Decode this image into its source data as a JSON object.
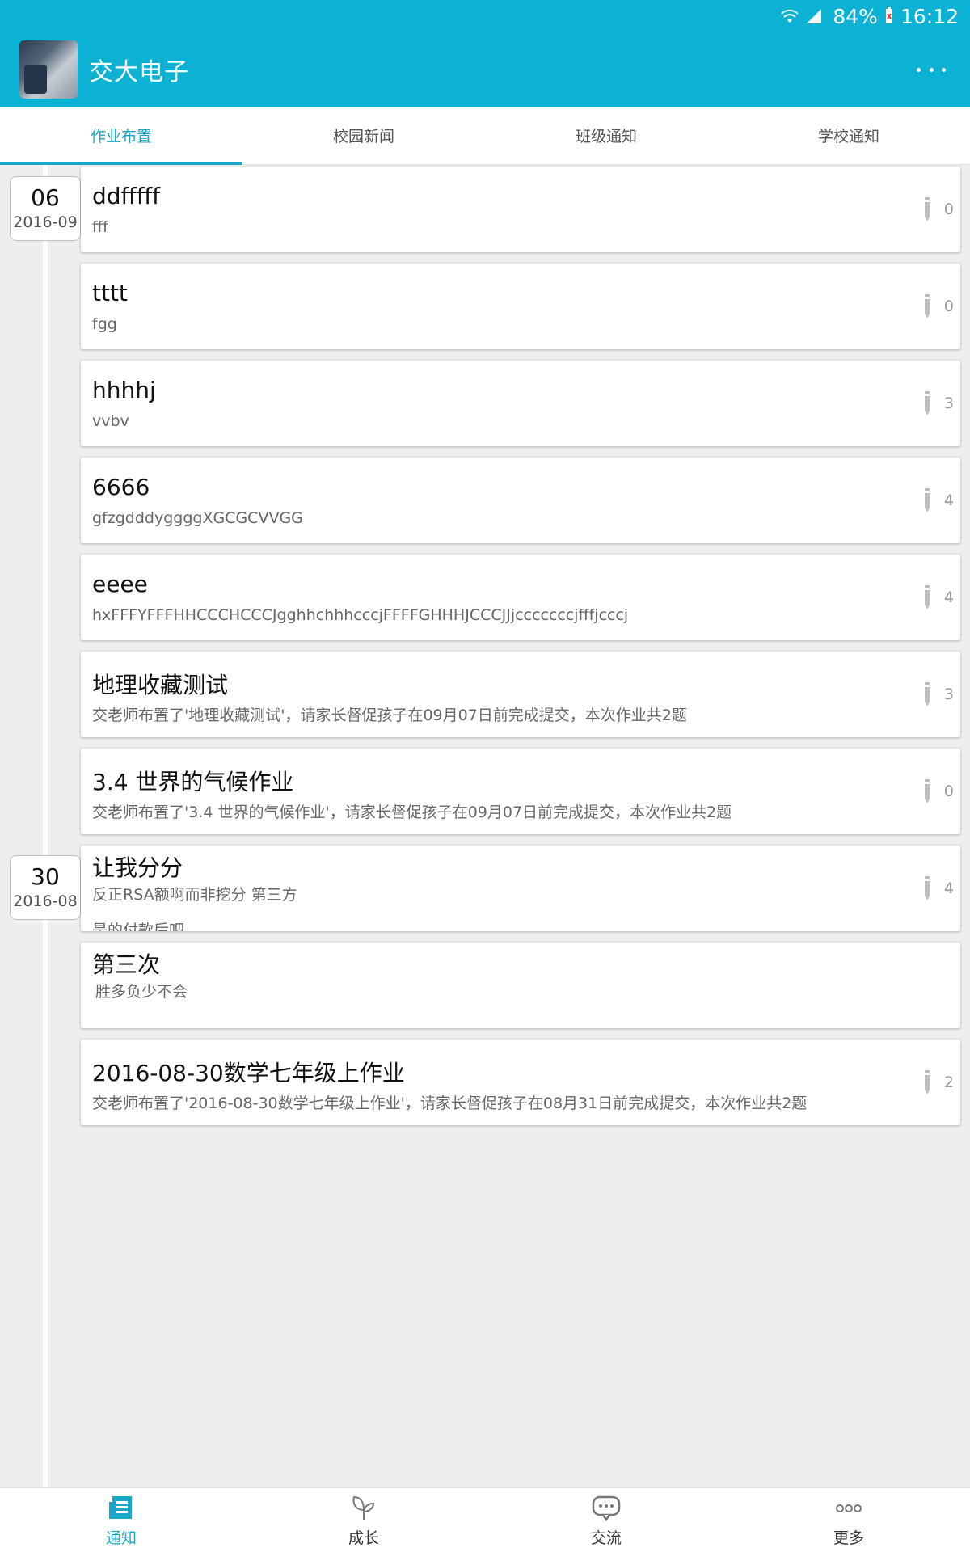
{
  "status_bar": {
    "battery": "84%",
    "time": "16:12"
  },
  "app_bar": {
    "title": "交大电子"
  },
  "tabs": [
    {
      "label": "作业布置",
      "active": true
    },
    {
      "label": "校园新闻",
      "active": false
    },
    {
      "label": "班级通知",
      "active": false
    },
    {
      "label": "学校通知",
      "active": false
    }
  ],
  "date_groups": [
    {
      "day": "06",
      "month": "2016-09"
    },
    {
      "day": "30",
      "month": "2016-08"
    }
  ],
  "cards": [
    {
      "title": "ddfffff",
      "subtitle": "fff",
      "count": "0"
    },
    {
      "title": "tttt",
      "subtitle": "fgg",
      "count": "0"
    },
    {
      "title": "hhhhj",
      "subtitle": "vvbv",
      "count": "3"
    },
    {
      "title": "6666",
      "subtitle": "gfzgdddyggggXGCGCVVGG",
      "count": "4"
    },
    {
      "title": "eeee",
      "subtitle": "hxFFFYFFFHHCCCHCCCJgghhchhhcccjFFFFGHHHJCCCJJjcccccccjfffjcccj",
      "count": "4"
    },
    {
      "title": "地理收藏测试",
      "subtitle": "交老师布置了'地理收藏测试'，请家长督促孩子在09月07日前完成提交，本次作业共2题",
      "count": "3"
    },
    {
      "title": "3.4 世界的气候作业",
      "subtitle": "交老师布置了'3.4 世界的气候作业'，请家长督促孩子在09月07日前完成提交，本次作业共2题",
      "count": "0"
    },
    {
      "title": "让我分分",
      "subtitle": "反正RSA额啊而非挖分 第三方",
      "subtitle2": "是的付款后吧",
      "count": "4"
    },
    {
      "title": "第三次",
      "subtitle": "胜多负少不会",
      "count": ""
    },
    {
      "title": "2016-08-30数学七年级上作业",
      "subtitle": "交老师布置了'2016-08-30数学七年级上作业'，请家长督促孩子在08月31日前完成提交，本次作业共2题",
      "count": "2"
    }
  ],
  "bottom_nav": [
    {
      "label": "通知",
      "icon": "notice-icon",
      "active": true
    },
    {
      "label": "成长",
      "icon": "sprout-icon",
      "active": false
    },
    {
      "label": "交流",
      "icon": "chat-icon",
      "active": false
    },
    {
      "label": "更多",
      "icon": "more-dots-icon",
      "active": false
    }
  ],
  "colors": {
    "primary": "#0bb2d3",
    "accent": "#1aa5c9",
    "background": "#eeeeee"
  }
}
